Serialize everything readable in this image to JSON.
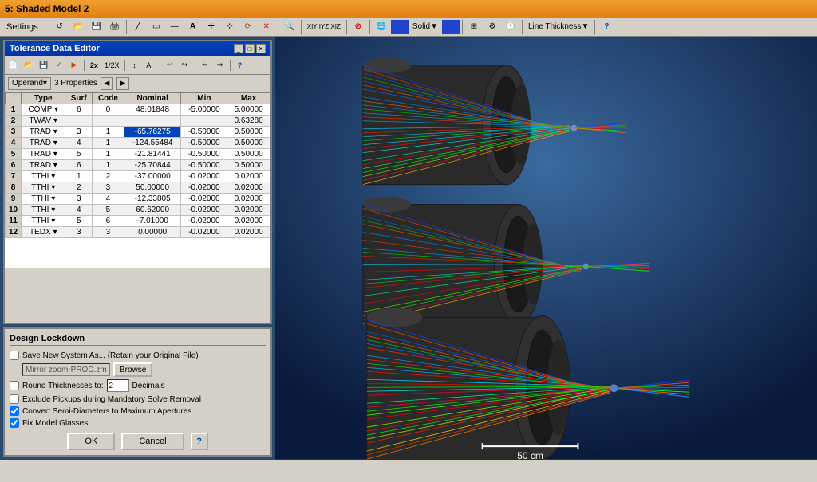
{
  "titleBar": {
    "title": "5: Shaded Model 2"
  },
  "menuBar": {
    "items": [
      "Settings"
    ]
  },
  "toolbar": {
    "solidLabel": "Solid",
    "lineThicknessLabel": "Line Thickness",
    "xiyizLabel": "XIY IYZ XIZ"
  },
  "tde": {
    "title": "Tolerance Data Editor",
    "operandLabel": "Operand",
    "propertiesLabel": "3 Properties",
    "columns": [
      "",
      "Type",
      "Surf",
      "Code",
      "Nominal",
      "Min",
      "Max"
    ],
    "rows": [
      {
        "num": "1",
        "type": "COMP",
        "surf": "6",
        "code": "0",
        "nominal": "48.01848",
        "min": "-5.00000",
        "max": "5.00000",
        "selected": false
      },
      {
        "num": "2",
        "type": "TWAV",
        "surf": "",
        "code": "",
        "nominal": "",
        "min": "",
        "max": "0.63280",
        "selected": false
      },
      {
        "num": "3",
        "type": "TRAD",
        "surf": "3",
        "code": "1",
        "nominal": "-65.76275",
        "min": "-0.50000",
        "max": "0.50000",
        "selected": true
      },
      {
        "num": "4",
        "type": "TRAD",
        "surf": "4",
        "code": "1",
        "nominal": "-124.55484",
        "min": "-0.50000",
        "max": "0.50000",
        "selected": false
      },
      {
        "num": "5",
        "type": "TRAD",
        "surf": "5",
        "code": "1",
        "nominal": "-21.81441",
        "min": "-0.50000",
        "max": "0.50000",
        "selected": false
      },
      {
        "num": "6",
        "type": "TRAD",
        "surf": "6",
        "code": "1",
        "nominal": "-25.70844",
        "min": "-0.50000",
        "max": "0.50000",
        "selected": false
      },
      {
        "num": "7",
        "type": "TTHI",
        "surf": "1",
        "code": "2",
        "nominal": "-37.00000",
        "min": "-0.02000",
        "max": "0.02000",
        "selected": false
      },
      {
        "num": "8",
        "type": "TTHI",
        "surf": "2",
        "code": "3",
        "nominal": "50.00000",
        "min": "-0.02000",
        "max": "0.02000",
        "selected": false
      },
      {
        "num": "9",
        "type": "TTHI",
        "surf": "3",
        "code": "4",
        "nominal": "-12.33805",
        "min": "-0.02000",
        "max": "0.02000",
        "selected": false
      },
      {
        "num": "10",
        "type": "TTHI",
        "surf": "4",
        "code": "5",
        "nominal": "60.62000",
        "min": "-0.02000",
        "max": "0.02000",
        "selected": false
      },
      {
        "num": "11",
        "type": "TTHI",
        "surf": "5",
        "code": "6",
        "nominal": "-7.01000",
        "min": "-0.02000",
        "max": "0.02000",
        "selected": false
      },
      {
        "num": "12",
        "type": "TEDX",
        "surf": "3",
        "code": "3",
        "nominal": "0.00000",
        "min": "-0.02000",
        "max": "0.02000",
        "selected": false
      }
    ]
  },
  "designLockdown": {
    "title": "Design Lockdown",
    "saveNewSystemLabel": "Save New System As... (Retain your Original File)",
    "saveNewSystemChecked": false,
    "mirrorZoomFile": "Mirror zoom-PROD.zmx",
    "browseLabel": "Browse",
    "roundThicknessesLabel": "Round Thicknesses to:",
    "roundThicknessesChecked": false,
    "roundDecimalsValue": "2",
    "decimalsLabel": "Decimals",
    "excludePickupsLabel": "Exclude Pickups during Mandatory Solve Removal",
    "excludePickupsChecked": false,
    "convertSemiDiametersLabel": "Convert Semi-Diameters to Maximum Apertures",
    "convertSemiDiametersChecked": true,
    "fixModelGlassesLabel": "Fix Model Glasses",
    "fixModelGlassesChecked": true,
    "okLabel": "OK",
    "cancelLabel": "Cancel"
  },
  "view3d": {
    "scaleLabel": "50 cm"
  },
  "colors": {
    "titleBarBg": "#e08010",
    "selectedRowBg": "#0044bb",
    "accentBlue": "#0033aa"
  }
}
